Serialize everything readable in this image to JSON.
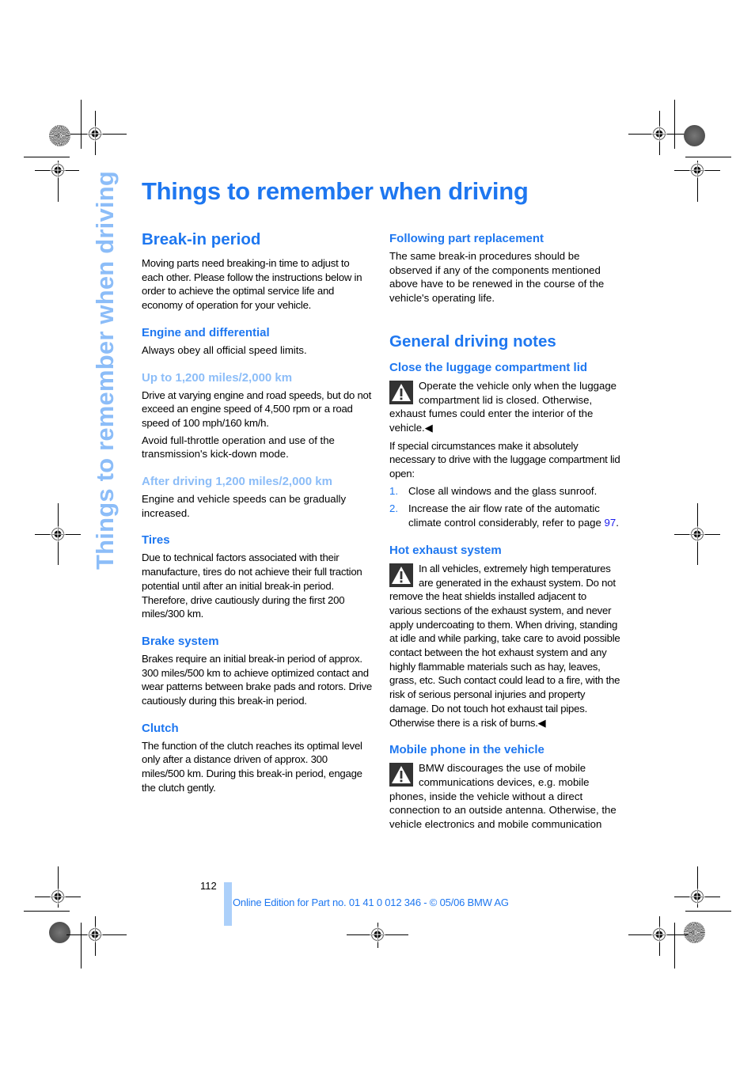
{
  "side_title": "Things to remember when driving",
  "page_title": "Things to remember when driving",
  "left_column": {
    "section_heading": "Break-in period",
    "intro": "Moving parts need breaking-in time to adjust to each other. Please follow the instructions below in order to achieve the optimal service life and economy of operation for your vehicle.",
    "engine": {
      "heading": "Engine and differential",
      "text": "Always obey all official speed limits."
    },
    "up_to": {
      "heading": "Up to 1,200 miles/2,000 km",
      "text1": "Drive at varying engine and road speeds, but do not exceed an engine speed of 4,500 rpm or a road speed of 100 mph/160 km/h.",
      "text2": "Avoid full-throttle operation and use of the transmission's kick-down mode."
    },
    "after": {
      "heading": "After driving 1,200 miles/2,000 km",
      "text": "Engine and vehicle speeds can be gradually increased."
    },
    "tires": {
      "heading": "Tires",
      "text": "Due to technical factors associated with their manufacture, tires do not achieve their full traction potential until after an initial break-in period. Therefore, drive cautiously during the first 200 miles/300 km."
    },
    "brakes": {
      "heading": "Brake system",
      "text": "Brakes require an initial break-in period of approx. 300 miles/500 km to achieve optimized contact and wear patterns between brake pads and rotors. Drive cautiously during this break-in period."
    },
    "clutch": {
      "heading": "Clutch",
      "text": "The function of the clutch reaches its optimal level only after a distance driven of approx. 300 miles/500 km. During this break-in period, engage the clutch gently."
    }
  },
  "right_column": {
    "part_replacement": {
      "heading": "Following part replacement",
      "text": "The same break-in procedures should be observed if any of the components mentioned above have to be renewed in the course of the vehicle's operating life."
    },
    "section_heading": "General driving notes",
    "luggage": {
      "heading": "Close the luggage compartment lid",
      "warning": "Operate the vehicle only when the luggage compartment lid is closed. Otherwise, exhaust fumes could enter the interior of the vehicle.◀",
      "text": "If special circumstances make it absolutely necessary to drive with the luggage compartment lid open:",
      "steps": [
        {
          "num": "1.",
          "text": "Close all windows and the glass sunroof."
        },
        {
          "num": "2.",
          "text": "Increase the air flow rate of the automatic climate control considerably, refer to page ",
          "link": "97",
          "after": "."
        }
      ]
    },
    "exhaust": {
      "heading": "Hot exhaust system",
      "warning": "In all vehicles, extremely high temperatures are generated in the exhaust system. Do not remove the heat shields installed adjacent to various sections of the exhaust system, and never apply undercoating to them. When driving, standing at idle and while parking, take care to avoid possible contact between the hot exhaust system and any highly flammable materials such as hay, leaves, grass, etc. Such contact could lead to a fire, with the risk of serious personal injuries and property damage. Do not touch hot exhaust tail pipes. Otherwise there is a risk of burns.◀"
    },
    "mobile": {
      "heading": "Mobile phone in the vehicle",
      "warning": "BMW discourages the use of mobile communications devices, e.g. mobile phones, inside the vehicle without a direct connection to an outside antenna. Otherwise, the vehicle electronics and mobile communication"
    }
  },
  "footer": {
    "page_number": "112",
    "edition": "Online Edition for Part no. 01 41 0 012 346 - © 05/06 BMW AG"
  },
  "icons": {
    "warning": "warning-triangle-icon",
    "registration": "registration-mark-icon",
    "color_bar": "print-rosette-icon"
  },
  "colors": {
    "heading_blue": "#1e77f0",
    "light_blue": "#8cbdf8",
    "footer_bar": "#acd0fa"
  }
}
